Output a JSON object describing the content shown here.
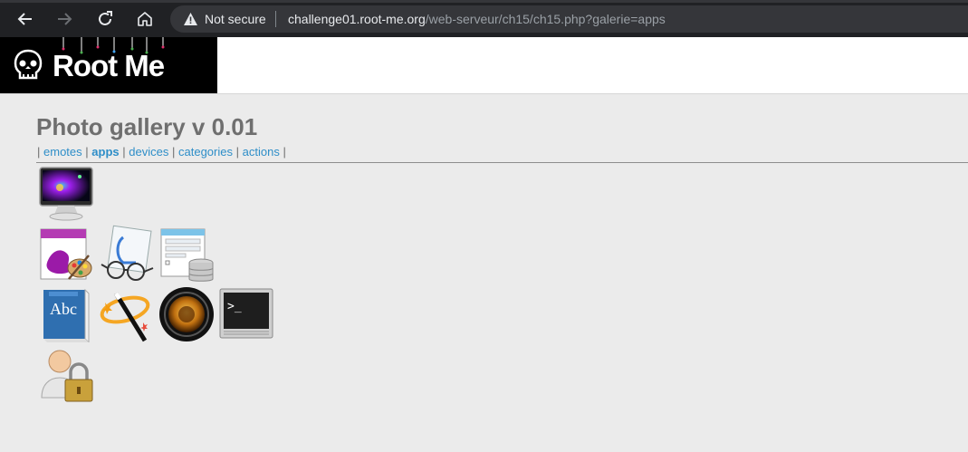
{
  "browser": {
    "security_label": "Not secure",
    "url_host": "challenge01.root-me.org",
    "url_path": "/web-serveur/ch15/ch15.php?galerie=apps",
    "icons": [
      "back-icon",
      "forward-icon",
      "reload-icon",
      "home-icon",
      "warning-icon"
    ]
  },
  "site": {
    "logo_text": "Root Me"
  },
  "page": {
    "title": "Photo gallery v 0.01",
    "nav": {
      "sep": "|",
      "items": [
        {
          "label": "emotes",
          "active": false
        },
        {
          "label": "apps",
          "active": true
        },
        {
          "label": "devices",
          "active": false
        },
        {
          "label": "categories",
          "active": false
        },
        {
          "label": "actions",
          "active": false
        }
      ]
    }
  },
  "gallery": {
    "images": [
      "monitor-icon",
      "paint-palette-icon",
      "preview-glasses-icon",
      "database-form-icon",
      "dictionary-book-icon",
      "magic-wand-icon",
      "camera-lens-icon",
      "terminal-icon",
      "user-lock-icon"
    ]
  },
  "colors": {
    "link": "#2e8ec8",
    "title": "#6f6f6f",
    "background": "#ebebeb",
    "browser_bar": "#202124"
  }
}
